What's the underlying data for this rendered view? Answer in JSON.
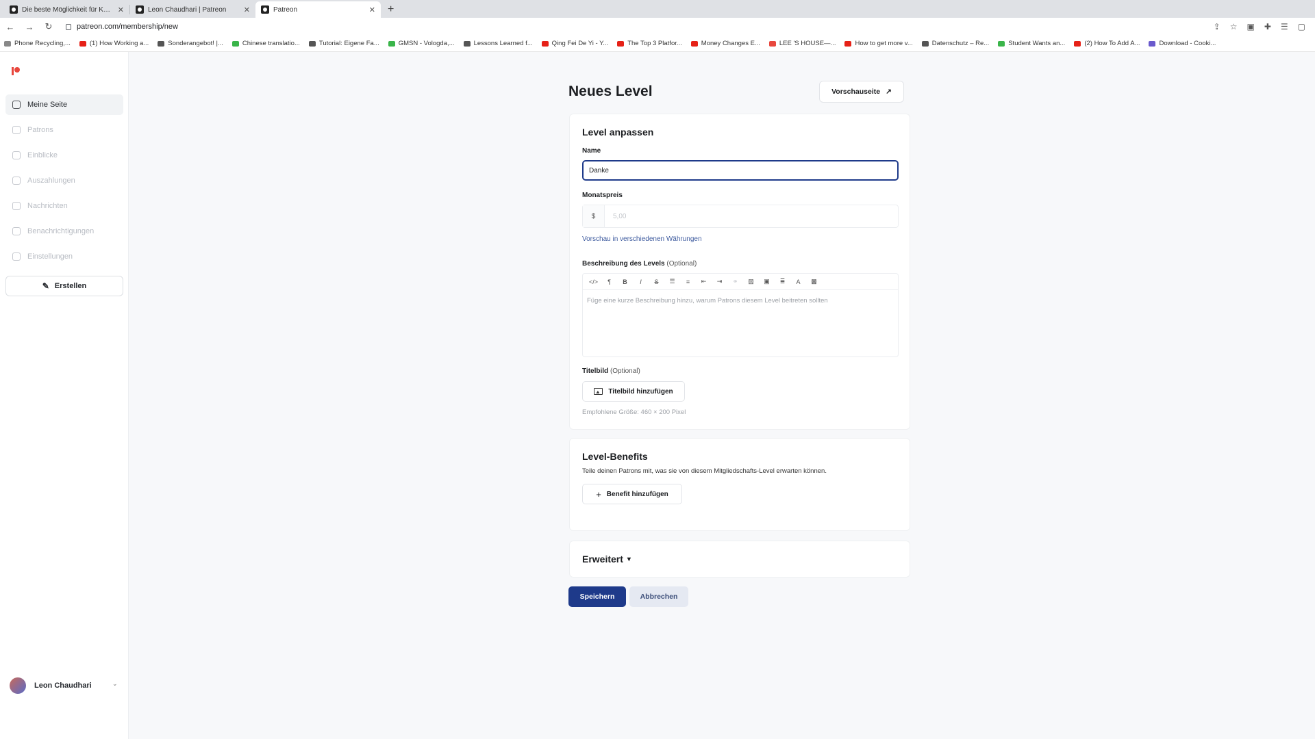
{
  "browser": {
    "tabs": [
      {
        "title": "Die beste Möglichkeit für Kün..."
      },
      {
        "title": "Leon Chaudhari | Patreon"
      },
      {
        "title": "Patreon"
      }
    ],
    "url": "patreon.com/membership/new",
    "bookmarks": [
      {
        "label": "Phone Recycling,...",
        "color": "#888888"
      },
      {
        "label": "(1) How Working a...",
        "color": "#e62117"
      },
      {
        "label": "Sonderangebot! |...",
        "color": "#555555"
      },
      {
        "label": "Chinese translatio...",
        "color": "#3ab54a"
      },
      {
        "label": "Tutorial: Eigene Fa...",
        "color": "#555555"
      },
      {
        "label": "GMSN - Vologda,...",
        "color": "#3ab54a"
      },
      {
        "label": "Lessons Learned f...",
        "color": "#555555"
      },
      {
        "label": "Qing Fei De Yi - Y...",
        "color": "#e62117"
      },
      {
        "label": "The Top 3 Platfor...",
        "color": "#e62117"
      },
      {
        "label": "Money Changes E...",
        "color": "#e62117"
      },
      {
        "label": "LEE 'S HOUSE—...",
        "color": "#e8473d"
      },
      {
        "label": "How to get more v...",
        "color": "#e62117"
      },
      {
        "label": "Datenschutz – Re...",
        "color": "#555555"
      },
      {
        "label": "Student Wants an...",
        "color": "#3ab54a"
      },
      {
        "label": "(2) How To Add A...",
        "color": "#e62117"
      },
      {
        "label": "Download - Cooki...",
        "color": "#6a5acd"
      }
    ]
  },
  "sidebar": {
    "items": [
      {
        "label": "Meine Seite",
        "active": true
      },
      {
        "label": "Patrons",
        "active": false
      },
      {
        "label": "Einblicke",
        "active": false
      },
      {
        "label": "Auszahlungen",
        "active": false
      },
      {
        "label": "Nachrichten",
        "active": false
      },
      {
        "label": "Benachrichtigungen",
        "active": false
      },
      {
        "label": "Einstellungen",
        "active": false
      }
    ],
    "create_label": "Erstellen",
    "user_name": "Leon Chaudhari"
  },
  "main": {
    "title": "Neues Level",
    "preview_label": "Vorschauseite",
    "customize": {
      "title": "Level anpassen",
      "name_label": "Name",
      "name_value": "Danke",
      "price_label": "Monatspreis",
      "currency_symbol": "$",
      "price_placeholder": "5,00",
      "currency_link": "Vorschau in verschiedenen Währungen",
      "description_label": "Beschreibung des Levels",
      "optional": "(Optional)",
      "description_placeholder": "Füge eine kurze Beschreibung hinzu, warum Patrons diesem Level beitreten sollten",
      "cover_label": "Titelbild",
      "cover_button": "Titelbild hinzufügen",
      "cover_hint": "Empfohlene Größe: 460 × 200 Pixel"
    },
    "benefits": {
      "title": "Level-Benefits",
      "subtitle": "Teile deinen Patrons mit, was sie von diesem Mitgliedschafts-Level erwarten können.",
      "add_button": "Benefit hinzufügen"
    },
    "advanced": {
      "title": "Erweitert"
    },
    "save_label": "Speichern",
    "cancel_label": "Abbrechen"
  },
  "colors": {
    "primary": "#1e3a8a",
    "brand": "#e8473d",
    "link": "#3d5a9e"
  }
}
